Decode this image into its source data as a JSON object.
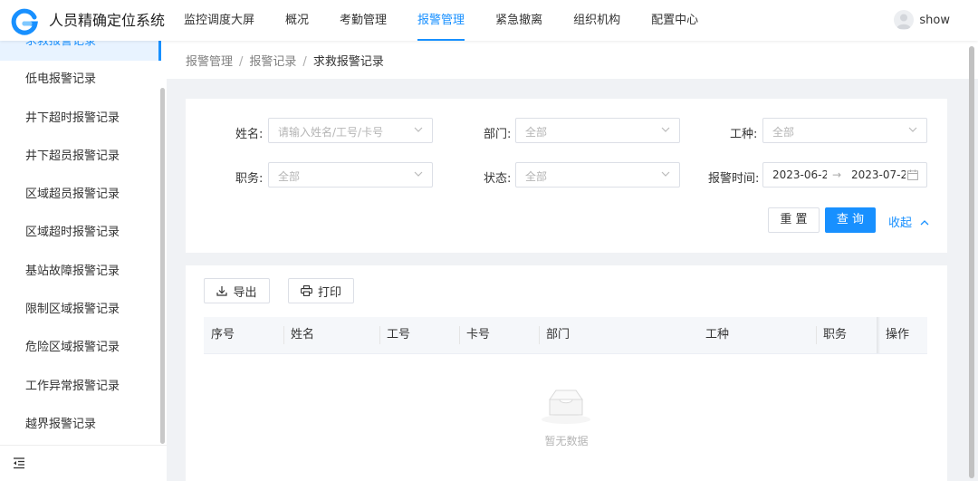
{
  "app": {
    "title": "人员精确定位系统",
    "brand_color": "#1890ff"
  },
  "nav": {
    "items": [
      "监控调度大屏",
      "概况",
      "考勤管理",
      "报警管理",
      "紧急撤离",
      "组织机构",
      "配置中心"
    ],
    "active_index": 3
  },
  "user": {
    "name": "show"
  },
  "sidebar": {
    "items": [
      "求救报警记录",
      "低电报警记录",
      "井下超时报警记录",
      "井下超员报警记录",
      "区域超员报警记录",
      "区域超时报警记录",
      "基站故障报警记录",
      "限制区域报警记录",
      "危险区域报警记录",
      "工作异常报警记录",
      "越界报警记录"
    ],
    "active_index": 0
  },
  "breadcrumb": {
    "items": [
      "报警管理",
      "报警记录",
      "求救报警记录"
    ],
    "separator": "/"
  },
  "filters": {
    "name": {
      "label": "姓名",
      "placeholder": "请输入姓名/工号/卡号"
    },
    "dept": {
      "label": "部门",
      "placeholder": "全部"
    },
    "worktype": {
      "label": "工种",
      "placeholder": "全部"
    },
    "post": {
      "label": "职务",
      "placeholder": "全部"
    },
    "status": {
      "label": "状态",
      "placeholder": "全部"
    },
    "alarm_time": {
      "label": "报警时间",
      "start": "2023-06-2",
      "end": "2023-07-2",
      "arrow": "→"
    },
    "colon": ":",
    "reset_label": "重 置",
    "query_label": "查 询",
    "collapse_label": "收起"
  },
  "toolbar": {
    "export_label": "导出",
    "print_label": "打印"
  },
  "table": {
    "columns": [
      "序号",
      "姓名",
      "工号",
      "卡号",
      "部门",
      "工种",
      "职务",
      "操作"
    ],
    "empty_text": "暂无数据"
  }
}
